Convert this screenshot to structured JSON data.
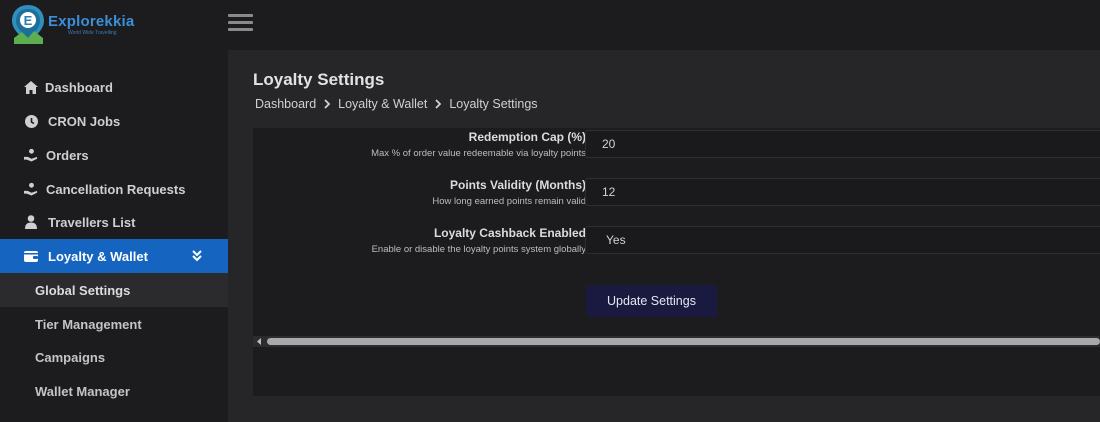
{
  "brand": {
    "name": "Explorekkia",
    "tagline": "World Wide Travelling",
    "colors": {
      "primary": "#3a8fd8",
      "accent": "#1565c0",
      "button": "#1a1a40"
    }
  },
  "header": {
    "menu_icon": "hamburger-icon"
  },
  "sidebar": {
    "items": [
      {
        "label": "Dashboard",
        "icon": "home-icon"
      },
      {
        "label": "CRON Jobs",
        "icon": "clock-icon"
      },
      {
        "label": "Orders",
        "icon": "hand-coin-icon"
      },
      {
        "label": "Cancellation Requests",
        "icon": "hand-coin-icon"
      },
      {
        "label": "Travellers List",
        "icon": "user-icon"
      },
      {
        "label": "Loyalty & Wallet",
        "icon": "wallet-icon",
        "expanded": true
      }
    ],
    "sub_items": [
      {
        "label": "Global Settings",
        "selected": true
      },
      {
        "label": "Tier Management"
      },
      {
        "label": "Campaigns"
      },
      {
        "label": "Wallet Manager"
      }
    ]
  },
  "main": {
    "title": "Loyalty Settings",
    "breadcrumb": [
      "Dashboard",
      "Loyalty & Wallet",
      "Loyalty Settings"
    ],
    "fields": [
      {
        "label": "Redemption Cap (%)",
        "help": "Max % of order value redeemable via loyalty points",
        "value": "20"
      },
      {
        "label": "Points Validity (Months)",
        "help": "How long earned points remain valid",
        "value": "12"
      },
      {
        "label": "Loyalty Cashback Enabled",
        "help": "Enable or disable the loyalty points system globally",
        "value": "Yes"
      }
    ],
    "submit_label": "Update Settings"
  }
}
